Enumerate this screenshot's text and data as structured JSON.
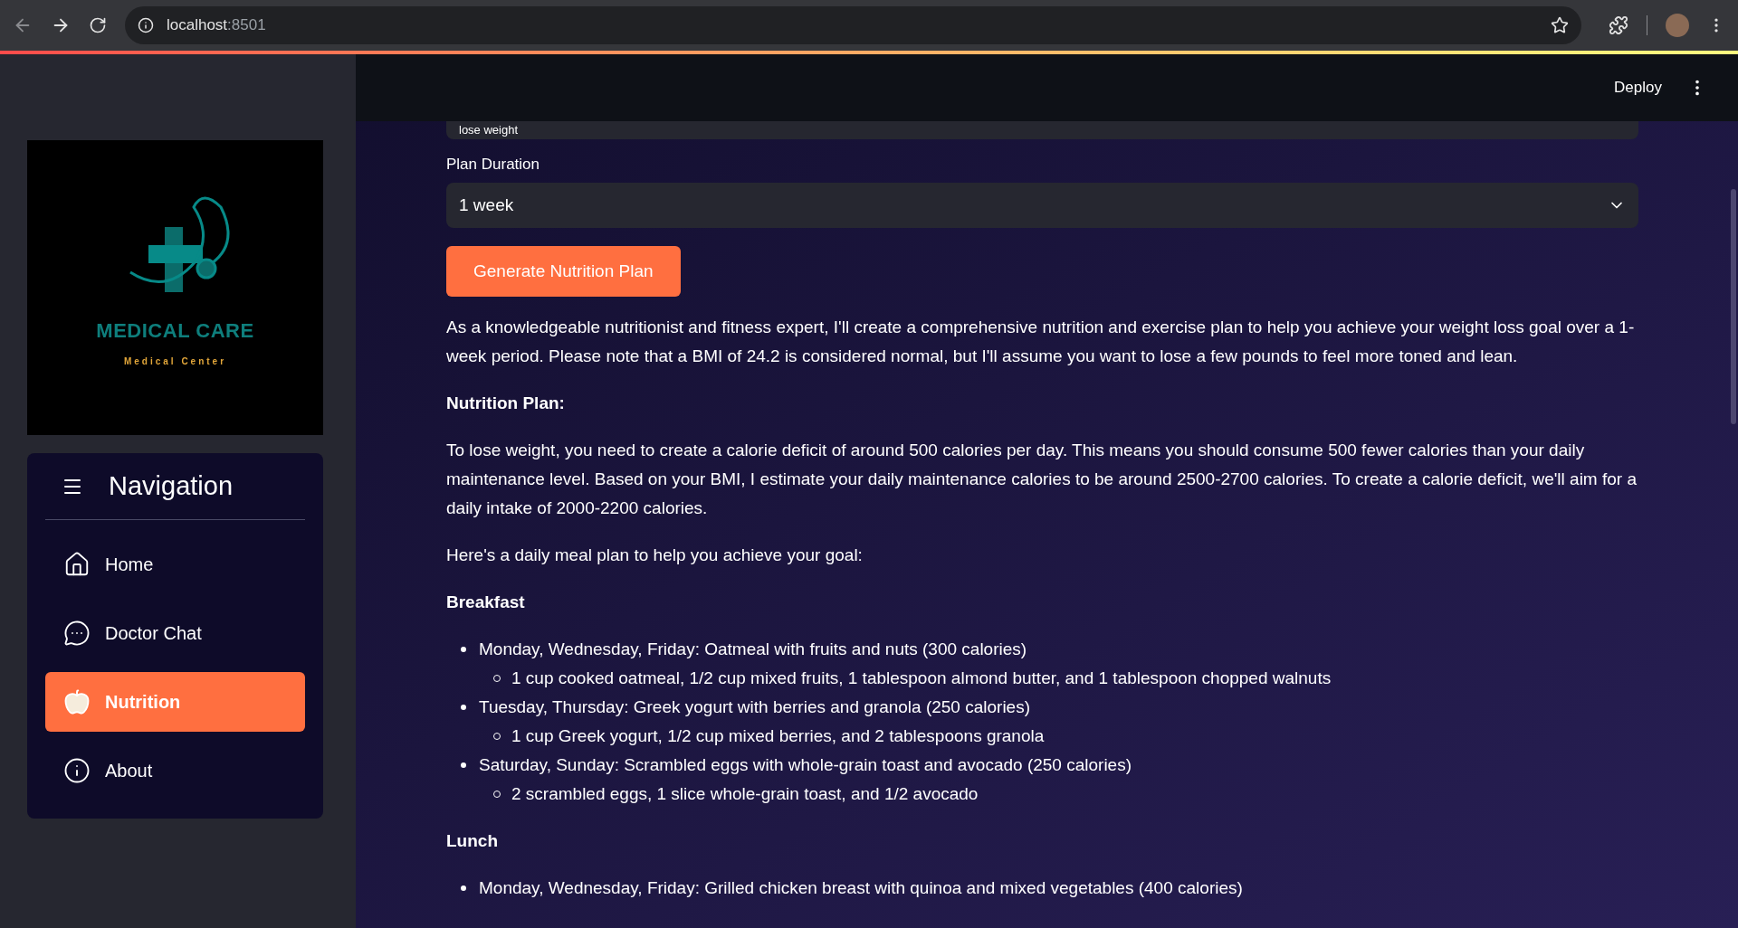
{
  "browser": {
    "host": "localhost",
    "port": ":8501"
  },
  "header": {
    "deploy": "Deploy"
  },
  "sidebar": {
    "logo": {
      "title": "MEDICAL CARE",
      "subtitle": "Medical Center"
    },
    "nav_title": "Navigation",
    "items": [
      {
        "label": "Home",
        "kind": "home",
        "selected": false
      },
      {
        "label": "Doctor Chat",
        "kind": "chat",
        "selected": false
      },
      {
        "label": "Nutrition",
        "kind": "apple",
        "selected": true
      },
      {
        "label": "About",
        "kind": "info",
        "selected": false
      }
    ]
  },
  "form": {
    "goal_value": "lose weight",
    "duration_label": "Plan Duration",
    "duration_value": "1 week",
    "button": "Generate Nutrition Plan"
  },
  "content": [
    {
      "kind": "paragraph",
      "text": "As a knowledgeable nutritionist and fitness expert, I'll create a comprehensive nutrition and exercise plan to help you achieve your weight loss goal over a 1-week period. Please note that a BMI of 24.2 is considered normal, but I'll assume you want to lose a few pounds to feel more toned and lean."
    },
    {
      "kind": "heading",
      "text": "Nutrition Plan:"
    },
    {
      "kind": "paragraph",
      "text": "To lose weight, you need to create a calorie deficit of around 500 calories per day. This means you should consume 500 fewer calories than your daily maintenance level. Based on your BMI, I estimate your daily maintenance calories to be around 2500-2700 calories. To create a calorie deficit, we'll aim for a daily intake of 2000-2200 calories."
    },
    {
      "kind": "paragraph",
      "text": "Here's a daily meal plan to help you achieve your goal:"
    },
    {
      "kind": "heading",
      "text": "Breakfast"
    },
    {
      "kind": "list",
      "items": [
        {
          "text": "Monday, Wednesday, Friday: Oatmeal with fruits and nuts (300 calories)",
          "children": [
            {
              "text": "1 cup cooked oatmeal, 1/2 cup mixed fruits, 1 tablespoon almond butter, and 1 tablespoon chopped walnuts"
            }
          ]
        },
        {
          "text": "Tuesday, Thursday: Greek yogurt with berries and granola (250 calories)",
          "children": [
            {
              "text": "1 cup Greek yogurt, 1/2 cup mixed berries, and 2 tablespoons granola"
            }
          ]
        },
        {
          "text": "Saturday, Sunday: Scrambled eggs with whole-grain toast and avocado (250 calories)",
          "children": [
            {
              "text": "2 scrambled eggs, 1 slice whole-grain toast, and 1/2 avocado"
            }
          ]
        }
      ]
    },
    {
      "kind": "heading",
      "text": "Lunch"
    },
    {
      "kind": "list",
      "items": [
        {
          "text": "Monday, Wednesday, Friday: Grilled chicken breast with quinoa and mixed vegetables (400 calories)"
        }
      ]
    }
  ]
}
